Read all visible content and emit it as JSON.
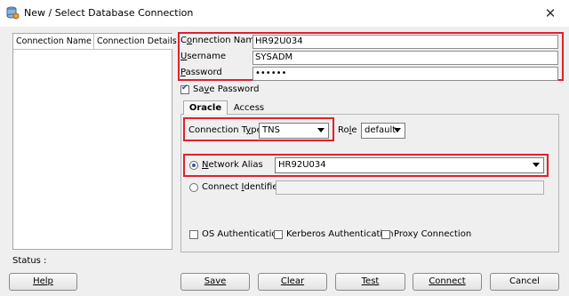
{
  "window": {
    "title": "New / Select Database Connection",
    "close_glyph": "✕"
  },
  "connections_list": {
    "columns": [
      "Connection Name",
      "Connection Details"
    ]
  },
  "status": {
    "label": "Status :"
  },
  "form": {
    "connection_name": {
      "label": "Connection Name",
      "value": "HR92U034"
    },
    "username": {
      "label": "Username",
      "value": "SYSADM"
    },
    "password": {
      "label": "Password",
      "value": "••••••"
    },
    "save_password": {
      "label": "Save Password",
      "checked": true
    }
  },
  "tabs": [
    {
      "label": "Oracle",
      "selected": true
    },
    {
      "label": "Access",
      "selected": false
    }
  ],
  "oracle": {
    "connection_type": {
      "label": "Connection Type",
      "value": "TNS"
    },
    "role": {
      "label": "Role",
      "value": "default"
    },
    "network_alias": {
      "label": "Network Alias",
      "value": "HR92U034",
      "selected": true
    },
    "connect_identifier": {
      "label": "Connect Identifier",
      "value": "",
      "selected": false
    },
    "os_auth": {
      "label": "OS Authentication",
      "checked": false
    },
    "kerberos_auth": {
      "label": "Kerberos Authentication",
      "checked": false
    },
    "proxy_conn": {
      "label": "Proxy Connection",
      "checked": false
    }
  },
  "buttons": {
    "help": "Help",
    "save": "Save",
    "clear": "Clear",
    "test": "Test",
    "connect": "Connect",
    "cancel": "Cancel"
  },
  "colors": {
    "highlight_box": "#e0202d",
    "dialog_bg": "#efefef"
  }
}
